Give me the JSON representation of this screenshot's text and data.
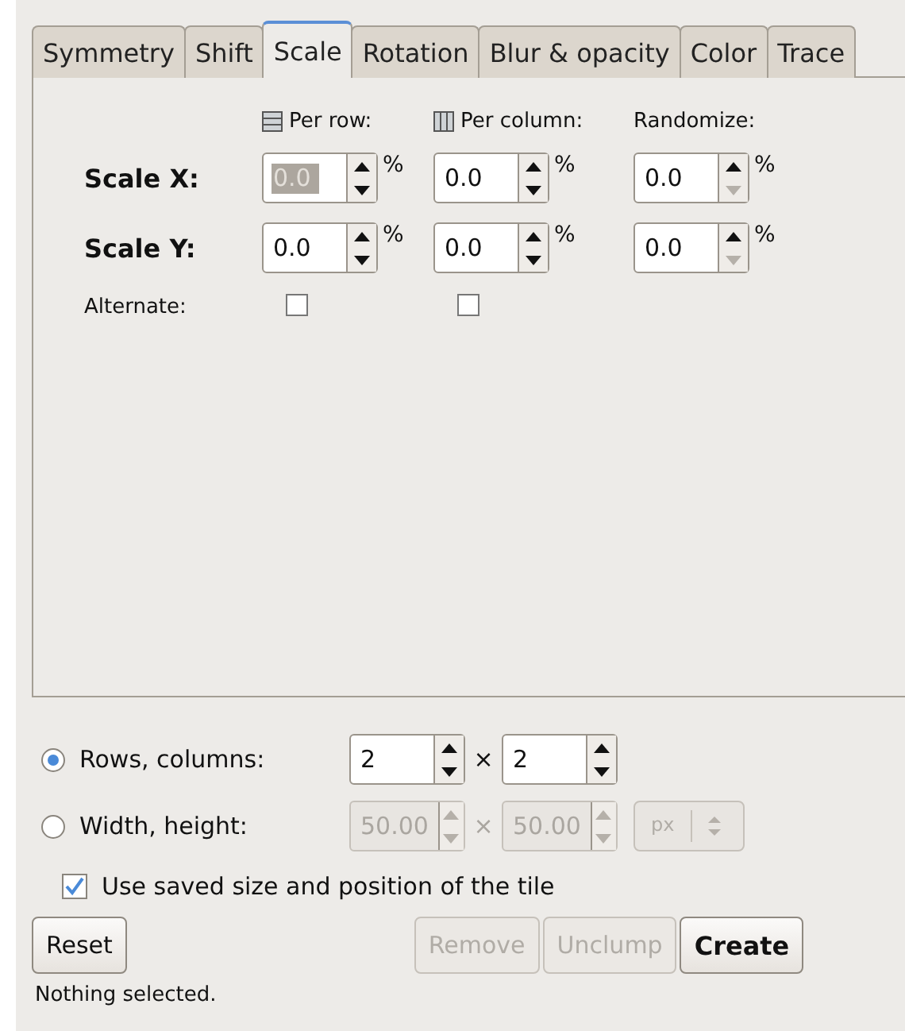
{
  "tabs": [
    {
      "label": "Symmetry",
      "selected": false
    },
    {
      "label": "Shift",
      "selected": false
    },
    {
      "label": "Scale",
      "selected": true
    },
    {
      "label": "Rotation",
      "selected": false
    },
    {
      "label": "Blur & opacity",
      "selected": false
    },
    {
      "label": "Color",
      "selected": false
    },
    {
      "label": "Trace",
      "selected": false
    }
  ],
  "column_headers": [
    {
      "label": "Per row:",
      "kind": "rows"
    },
    {
      "label": "Per column:",
      "kind": "columns"
    },
    {
      "label": "Randomize:",
      "kind": "plain"
    }
  ],
  "scale_rows": [
    {
      "label": "Scale X:",
      "fields": [
        {
          "value": "0.0",
          "unit": "%",
          "text_selected": true,
          "down_disabled": false
        },
        {
          "value": "0.0",
          "unit": "%",
          "text_selected": false,
          "down_disabled": false
        },
        {
          "value": "0.0",
          "unit": "%",
          "text_selected": false,
          "down_disabled": true
        }
      ]
    },
    {
      "label": "Scale Y:",
      "fields": [
        {
          "value": "0.0",
          "unit": "%",
          "text_selected": false,
          "down_disabled": false
        },
        {
          "value": "0.0",
          "unit": "%",
          "text_selected": false,
          "down_disabled": false
        },
        {
          "value": "0.0",
          "unit": "%",
          "text_selected": false,
          "down_disabled": true
        }
      ]
    }
  ],
  "alternate": {
    "label": "Alternate:",
    "checkboxes": [
      {
        "checked": false
      },
      {
        "checked": false
      }
    ]
  },
  "size_options": [
    {
      "label": "Rows, columns:",
      "selected": true,
      "first": "2",
      "times": "×",
      "second": "2",
      "disabled": false
    },
    {
      "label": "Width, height:",
      "selected": false,
      "first": "50.00",
      "times": "×",
      "second": "50.00",
      "disabled": true,
      "unit": "px"
    }
  ],
  "use_saved": {
    "label": "Use saved size and position of the tile",
    "checked": true
  },
  "buttons": [
    {
      "label": "Reset",
      "disabled": false,
      "bold": false
    },
    {
      "label": "Remove",
      "disabled": true,
      "bold": false
    },
    {
      "label": "Unclump",
      "disabled": true,
      "bold": false
    },
    {
      "label": "Create",
      "disabled": false,
      "bold": true
    }
  ],
  "status": "Nothing selected."
}
